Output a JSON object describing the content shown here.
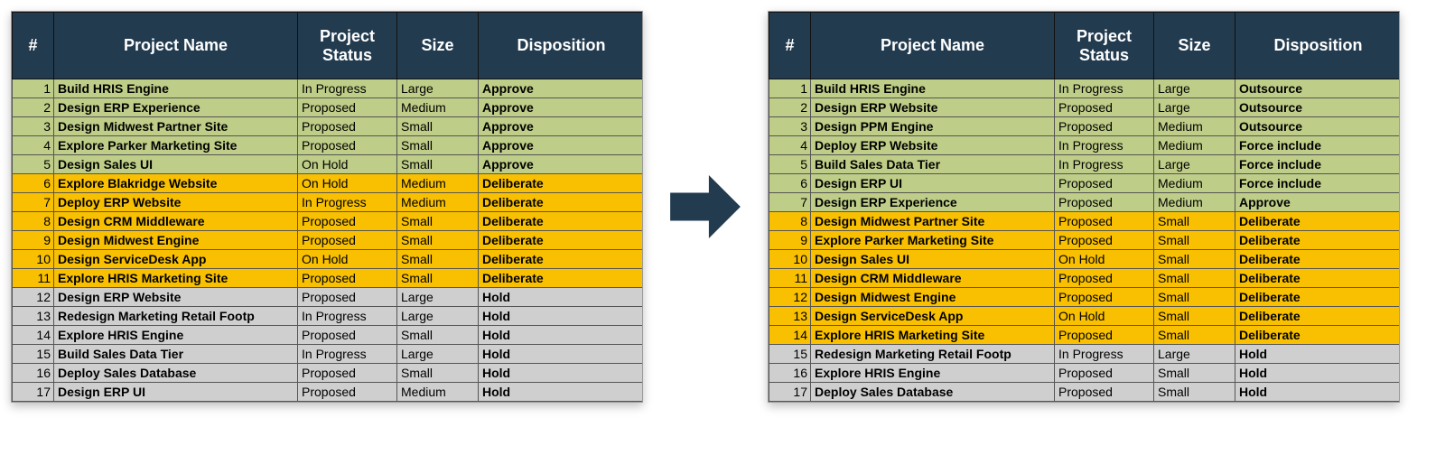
{
  "columns": [
    "#",
    "Project Name",
    "Project\nStatus",
    "Size",
    "Disposition"
  ],
  "tables": {
    "left": {
      "rows": [
        {
          "n": 1,
          "name": "Build HRIS Engine",
          "status": "In Progress",
          "size": "Large",
          "disp": "Approve",
          "cls": "green"
        },
        {
          "n": 2,
          "name": "Design ERP Experience",
          "status": "Proposed",
          "size": "Medium",
          "disp": "Approve",
          "cls": "green"
        },
        {
          "n": 3,
          "name": "Design Midwest Partner Site",
          "status": "Proposed",
          "size": "Small",
          "disp": "Approve",
          "cls": "green"
        },
        {
          "n": 4,
          "name": "Explore Parker Marketing Site",
          "status": "Proposed",
          "size": "Small",
          "disp": "Approve",
          "cls": "green"
        },
        {
          "n": 5,
          "name": "Design Sales UI",
          "status": "On Hold",
          "size": "Small",
          "disp": "Approve",
          "cls": "green"
        },
        {
          "n": 6,
          "name": "Explore Blakridge Website",
          "status": "On Hold",
          "size": "Medium",
          "disp": "Deliberate",
          "cls": "deliberate"
        },
        {
          "n": 7,
          "name": "Deploy ERP Website",
          "status": "In Progress",
          "size": "Medium",
          "disp": "Deliberate",
          "cls": "deliberate"
        },
        {
          "n": 8,
          "name": "Design CRM Middleware",
          "status": "Proposed",
          "size": "Small",
          "disp": "Deliberate",
          "cls": "deliberate"
        },
        {
          "n": 9,
          "name": "Design Midwest Engine",
          "status": "Proposed",
          "size": "Small",
          "disp": "Deliberate",
          "cls": "deliberate"
        },
        {
          "n": 10,
          "name": "Design ServiceDesk App",
          "status": "On Hold",
          "size": "Small",
          "disp": "Deliberate",
          "cls": "deliberate"
        },
        {
          "n": 11,
          "name": "Explore HRIS Marketing Site",
          "status": "Proposed",
          "size": "Small",
          "disp": "Deliberate",
          "cls": "deliberate"
        },
        {
          "n": 12,
          "name": "Design ERP Website",
          "status": "Proposed",
          "size": "Large",
          "disp": "Hold",
          "cls": "hold"
        },
        {
          "n": 13,
          "name": "Redesign Marketing Retail Footp",
          "status": "In Progress",
          "size": "Large",
          "disp": "Hold",
          "cls": "hold"
        },
        {
          "n": 14,
          "name": "Explore HRIS Engine",
          "status": "Proposed",
          "size": "Small",
          "disp": "Hold",
          "cls": "hold"
        },
        {
          "n": 15,
          "name": "Build Sales Data Tier",
          "status": "In Progress",
          "size": "Large",
          "disp": "Hold",
          "cls": "hold"
        },
        {
          "n": 16,
          "name": "Deploy Sales Database",
          "status": "Proposed",
          "size": "Small",
          "disp": "Hold",
          "cls": "hold"
        },
        {
          "n": 17,
          "name": "Design ERP UI",
          "status": "Proposed",
          "size": "Medium",
          "disp": "Hold",
          "cls": "hold"
        }
      ]
    },
    "right": {
      "rows": [
        {
          "n": 1,
          "name": "Build HRIS Engine",
          "status": "In Progress",
          "size": "Large",
          "disp": "Outsource",
          "cls": "green"
        },
        {
          "n": 2,
          "name": "Design ERP Website",
          "status": "Proposed",
          "size": "Large",
          "disp": "Outsource",
          "cls": "green"
        },
        {
          "n": 3,
          "name": "Design PPM Engine",
          "status": "Proposed",
          "size": "Medium",
          "disp": "Outsource",
          "cls": "green"
        },
        {
          "n": 4,
          "name": "Deploy ERP Website",
          "status": "In Progress",
          "size": "Medium",
          "disp": "Force include",
          "cls": "green"
        },
        {
          "n": 5,
          "name": "Build Sales Data Tier",
          "status": "In Progress",
          "size": "Large",
          "disp": "Force include",
          "cls": "green"
        },
        {
          "n": 6,
          "name": "Design ERP UI",
          "status": "Proposed",
          "size": "Medium",
          "disp": "Force include",
          "cls": "green"
        },
        {
          "n": 7,
          "name": "Design ERP Experience",
          "status": "Proposed",
          "size": "Medium",
          "disp": "Approve",
          "cls": "green"
        },
        {
          "n": 8,
          "name": "Design Midwest Partner Site",
          "status": "Proposed",
          "size": "Small",
          "disp": "Deliberate",
          "cls": "deliberate"
        },
        {
          "n": 9,
          "name": "Explore Parker Marketing Site",
          "status": "Proposed",
          "size": "Small",
          "disp": "Deliberate",
          "cls": "deliberate"
        },
        {
          "n": 10,
          "name": "Design Sales UI",
          "status": "On Hold",
          "size": "Small",
          "disp": "Deliberate",
          "cls": "deliberate"
        },
        {
          "n": 11,
          "name": "Design CRM Middleware",
          "status": "Proposed",
          "size": "Small",
          "disp": "Deliberate",
          "cls": "deliberate"
        },
        {
          "n": 12,
          "name": "Design Midwest Engine",
          "status": "Proposed",
          "size": "Small",
          "disp": "Deliberate",
          "cls": "deliberate"
        },
        {
          "n": 13,
          "name": "Design ServiceDesk App",
          "status": "On Hold",
          "size": "Small",
          "disp": "Deliberate",
          "cls": "deliberate"
        },
        {
          "n": 14,
          "name": "Explore HRIS Marketing Site",
          "status": "Proposed",
          "size": "Small",
          "disp": "Deliberate",
          "cls": "deliberate"
        },
        {
          "n": 15,
          "name": "Redesign Marketing Retail Footp",
          "status": "In Progress",
          "size": "Large",
          "disp": "Hold",
          "cls": "hold"
        },
        {
          "n": 16,
          "name": "Explore HRIS Engine",
          "status": "Proposed",
          "size": "Small",
          "disp": "Hold",
          "cls": "hold"
        },
        {
          "n": 17,
          "name": "Deploy Sales Database",
          "status": "Proposed",
          "size": "Small",
          "disp": "Hold",
          "cls": "hold"
        }
      ]
    }
  },
  "colors": {
    "header_bg": "#223b4f",
    "green": "#becd87",
    "yellow": "#f8c000",
    "grey": "#cfcfcf",
    "arrow": "#223b4f"
  }
}
